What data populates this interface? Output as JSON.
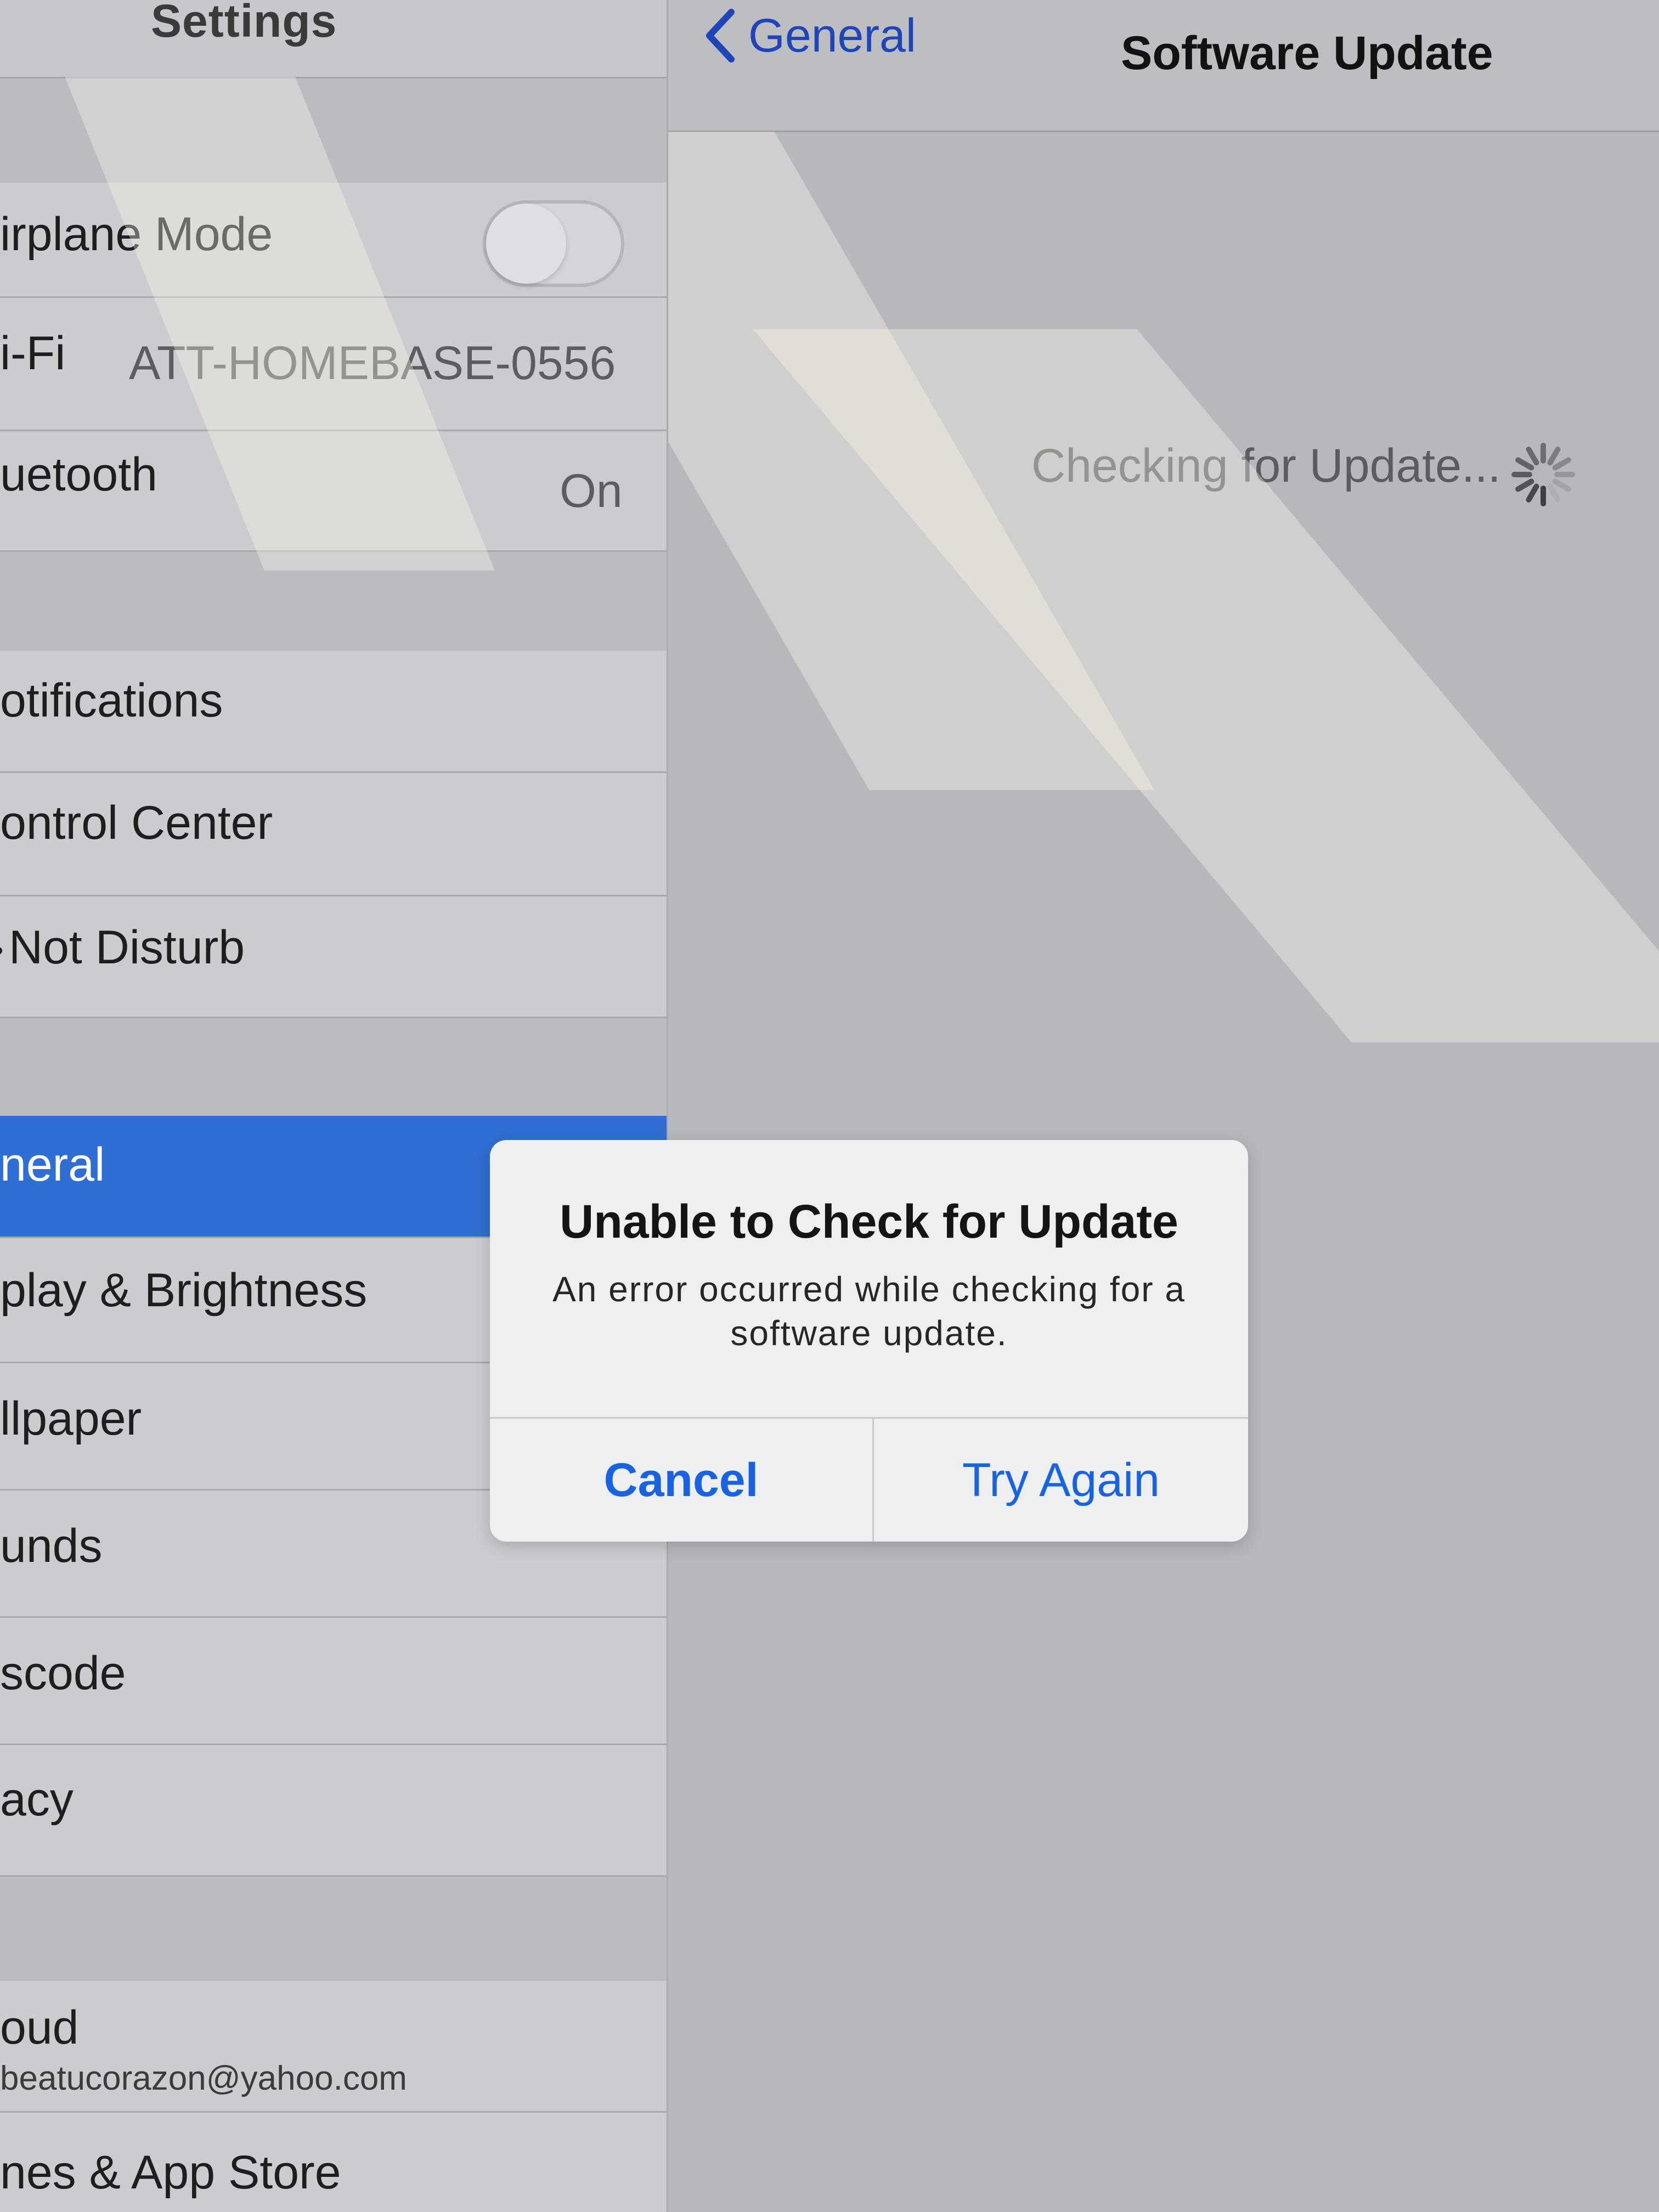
{
  "sidebar": {
    "title": "Settings",
    "airplane_mode_label": "irplane Mode",
    "wifi_label": "i-Fi",
    "wifi_value": "ATT-HOMEBASE-0556",
    "bluetooth_label": "uetooth",
    "bluetooth_value": "On",
    "notifications_label": "otifications",
    "control_center_label": "ontrol Center",
    "dnd_label": "Not Disturb",
    "general_label": "neral",
    "display_label": "play & Brightness",
    "wallpaper_label": "llpaper",
    "sounds_label": "unds",
    "passcode_label": "scode",
    "privacy_label": "acy",
    "icloud_label": "oud",
    "icloud_account": "beatucorazon@yahoo.com",
    "itunes_label": "nes & App Store"
  },
  "detail": {
    "back_label": "General",
    "title": "Software Update",
    "status": "Checking for Update..."
  },
  "alert": {
    "title": "Unable to Check for Update",
    "message": "An error occurred while checking for a software update.",
    "cancel_label": "Cancel",
    "try_again_label": "Try Again"
  },
  "colors": {
    "accent": "#1a63e0",
    "selected_row": "#2f6fd3"
  },
  "icons": [
    "chevron-left-icon",
    "activity-spinner-icon"
  ]
}
